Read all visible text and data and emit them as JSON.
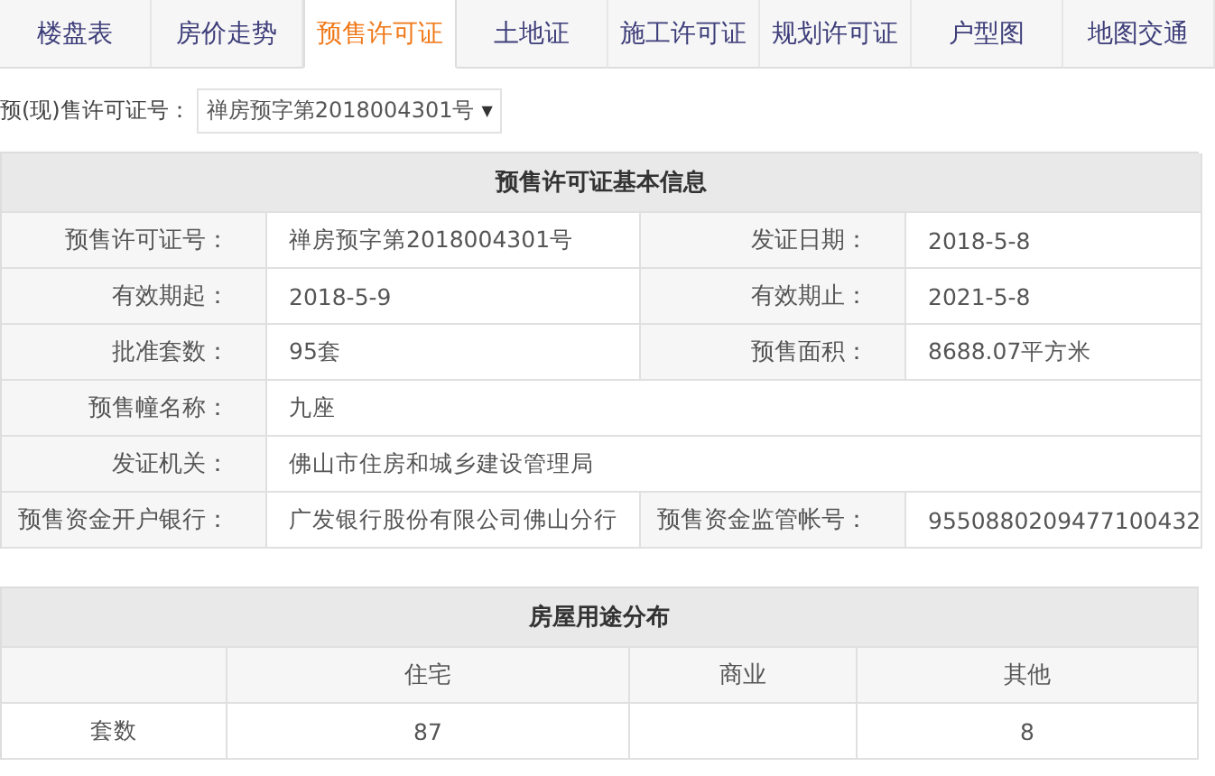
{
  "tabs": [
    {
      "label": "楼盘表",
      "selected": false
    },
    {
      "label": "房价走势",
      "selected": false
    },
    {
      "label": "预售许可证",
      "selected": true
    },
    {
      "label": "土地证",
      "selected": false
    },
    {
      "label": "施工许可证",
      "selected": false
    },
    {
      "label": "规划许可证",
      "selected": false
    },
    {
      "label": "户型图",
      "selected": false
    },
    {
      "label": "地图交通",
      "selected": false
    }
  ],
  "permit_select": {
    "label": "预(现)售许可证号：",
    "value": "禅房预字第2018004301号",
    "arrow": "▼"
  },
  "basic_info": {
    "title": "预售许可证基本信息",
    "rows": [
      {
        "fields": [
          {
            "label": "预售许可证号：",
            "value": "禅房预字第2018004301号"
          },
          {
            "label": "发证日期：",
            "value": "2018-5-8"
          }
        ]
      },
      {
        "fields": [
          {
            "label": "有效期起：",
            "value": "2018-5-9"
          },
          {
            "label": "有效期止：",
            "value": "2021-5-8"
          }
        ]
      },
      {
        "fields": [
          {
            "label": "批准套数：",
            "value": "95套"
          },
          {
            "label": "预售面积：",
            "value": "8688.07平方米"
          }
        ]
      },
      {
        "fields": [
          {
            "label": "预售幢名称：",
            "value": "九座"
          }
        ]
      },
      {
        "fields": [
          {
            "label": "发证机关：",
            "value": "佛山市住房和城乡建设管理局"
          }
        ]
      },
      {
        "fields": [
          {
            "label": "预售资金开户银行：",
            "value": "广发银行股份有限公司佛山分行"
          },
          {
            "label": "预售资金监管帐号：",
            "value": "9550880209477100432"
          }
        ]
      }
    ]
  },
  "usage": {
    "title": "房屋用途分布",
    "row_label": "套数",
    "columns": [
      {
        "label": "住宅",
        "count": "87"
      },
      {
        "label": "商业"
      },
      {
        "label": "其他",
        "count": "8"
      }
    ]
  }
}
